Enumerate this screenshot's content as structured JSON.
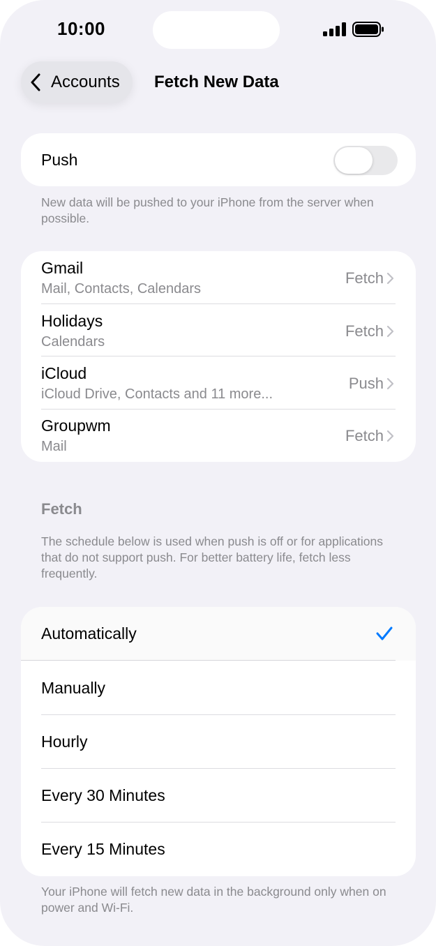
{
  "status_bar": {
    "time": "10:00"
  },
  "nav": {
    "back_label": "Accounts",
    "title": "Fetch New Data"
  },
  "push": {
    "label": "Push",
    "enabled": false,
    "footer": "New data will be pushed to your iPhone from the server when possible."
  },
  "accounts": [
    {
      "name": "Gmail",
      "detail": "Mail, Contacts, Calendars",
      "value": "Fetch"
    },
    {
      "name": "Holidays",
      "detail": "Calendars",
      "value": "Fetch"
    },
    {
      "name": "iCloud",
      "detail": "iCloud Drive, Contacts and 11 more...",
      "value": "Push"
    },
    {
      "name": "Groupwm",
      "detail": "Mail",
      "value": "Fetch"
    }
  ],
  "fetch": {
    "header": "Fetch",
    "description": "The schedule below is used when push is off or for applications that do not support push. For better battery life, fetch less frequently.",
    "options": [
      "Automatically",
      "Manually",
      "Hourly",
      "Every 30 Minutes",
      "Every 15 Minutes"
    ],
    "selected": "Automatically",
    "footer": "Your iPhone will fetch new data in the background only when on power and Wi-Fi."
  },
  "colors": {
    "accent": "#007aff",
    "background": "#f2f1f7",
    "secondary_text": "#8a8a8e"
  }
}
